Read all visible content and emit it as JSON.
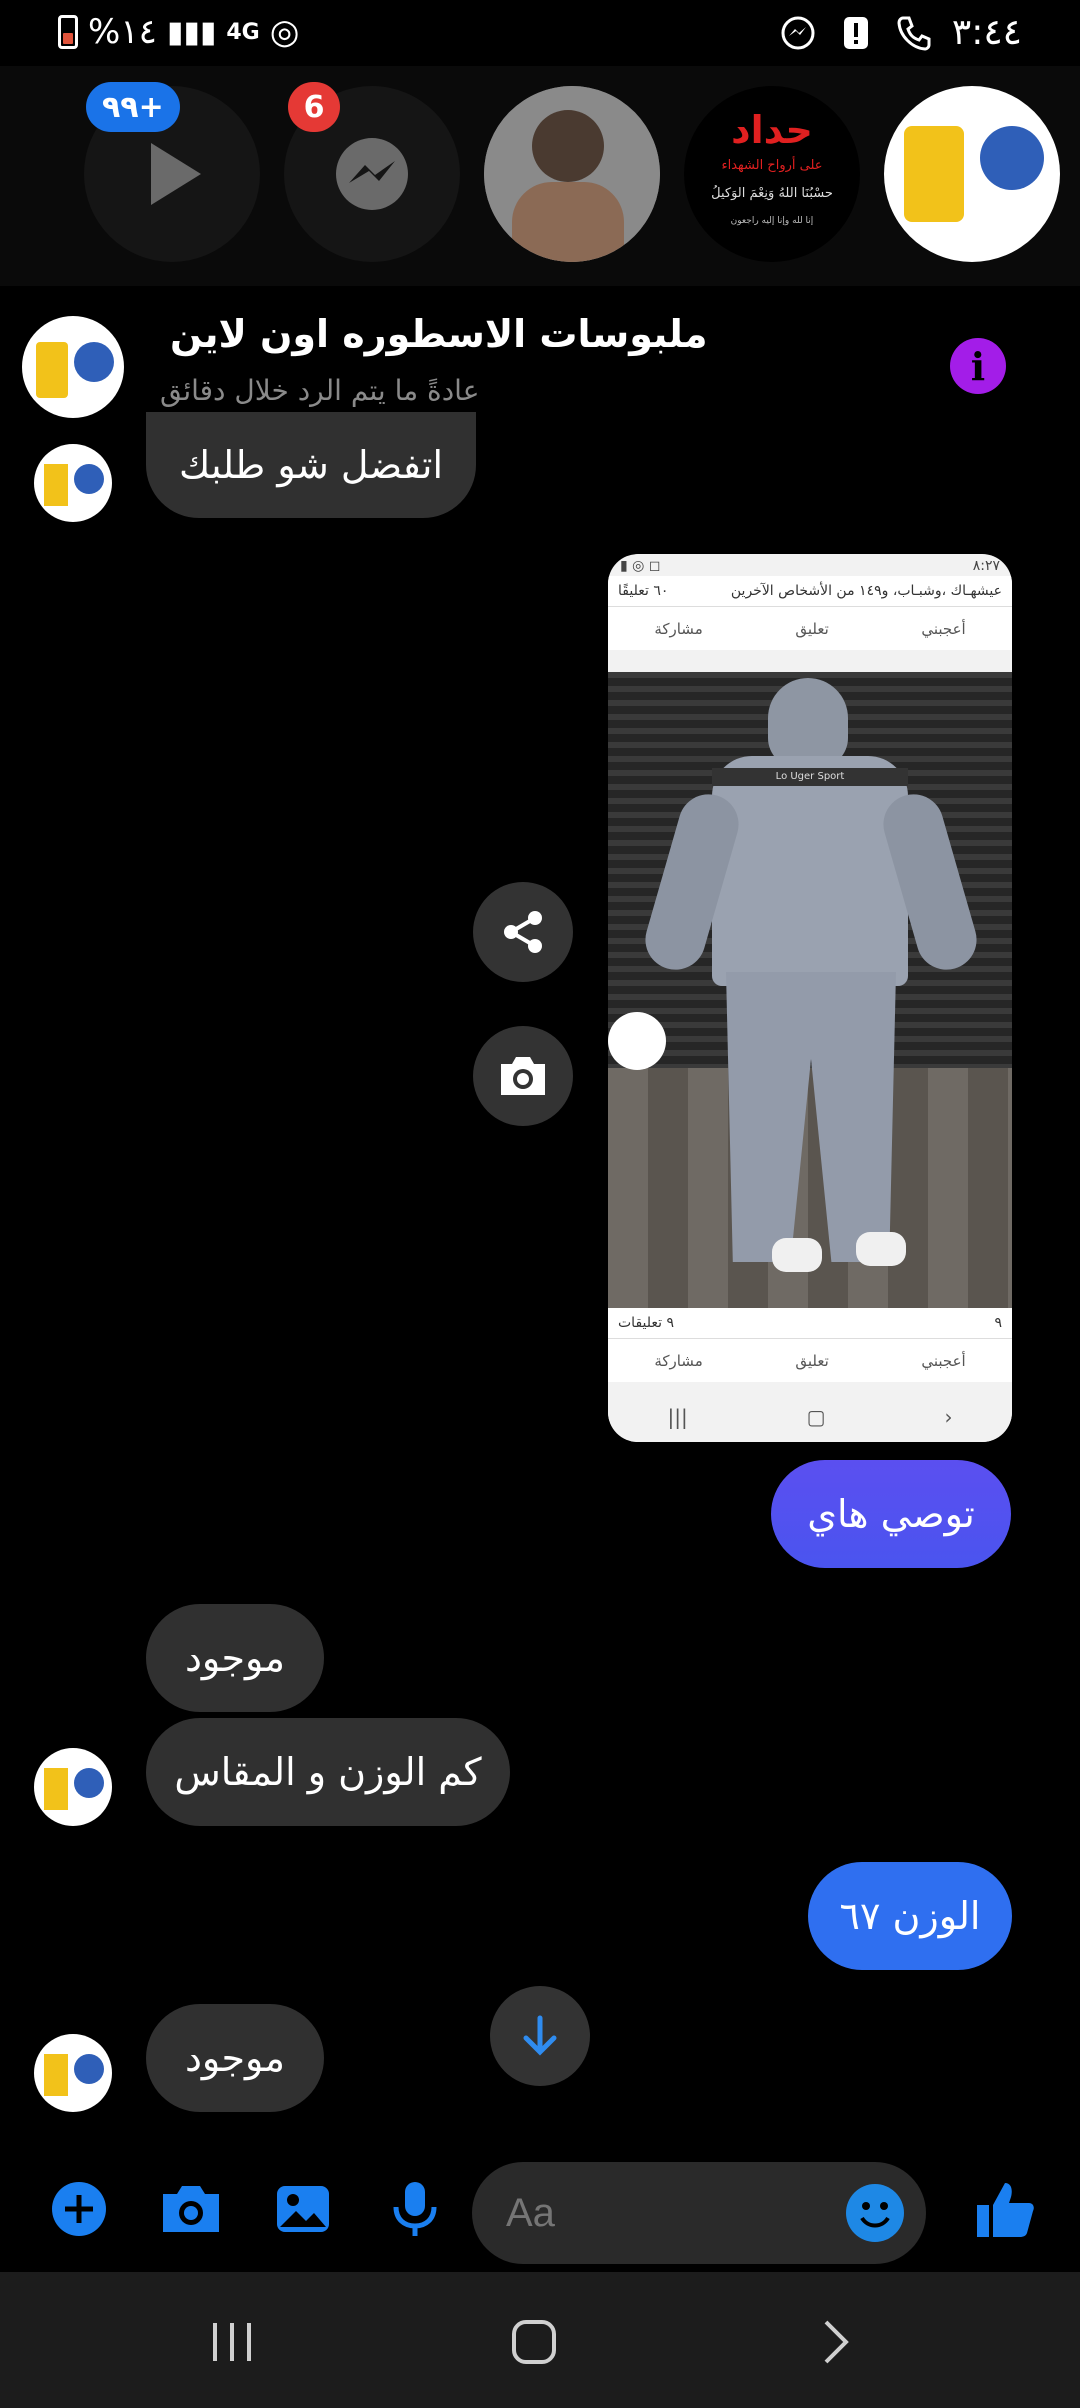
{
  "status_bar": {
    "battery_percent": "%١٤",
    "network": "4G",
    "time": "٣:٤٤"
  },
  "chat_heads": {
    "badge_watch": "٩٩+",
    "badge_messenger": "6",
    "ad_text_1": "حداد",
    "ad_text_2": "على أرواح الشهداء",
    "ad_text_3": "حسْبُنَا اللهُ وَنِعْمَ الوَكيلُ",
    "ad_text_4": "إنا لله وإنا إليه راجعون"
  },
  "chat": {
    "title": "ملبوسات الاسطوره اون لاين",
    "subtitle": "عادةً ما يتم الرد خلال دقائق"
  },
  "messages": {
    "m1": "اتفضل شو طلبك",
    "m2": "توصي هاي",
    "m3": "موجود",
    "m4": "كم الوزن و المقاس",
    "m5": "الوزن ٦٧",
    "m6": "موجود"
  },
  "shared_image": {
    "status_time": "٨:٢٧",
    "top_text": "عيشهـاك ،وشبـاب، و١٤٩ من الأشخاص الآخرين",
    "top_comments": "٦٠ تعليقًا",
    "like": "أعجبني",
    "comment": "تعليق",
    "share": "مشاركة",
    "bottom_likes": "٩",
    "bottom_comments": "٩ تعليقات",
    "brand_text": "Lo Uger Sport"
  },
  "composer": {
    "placeholder": "Aa"
  },
  "colors": {
    "outgoing_gradient_top": "#5b4ff0",
    "outgoing_gradient_bottom": "#2f6ff0",
    "incoming_bubble": "#303030",
    "accent_blue": "#1a73e8",
    "info_purple": "#a31de8"
  }
}
